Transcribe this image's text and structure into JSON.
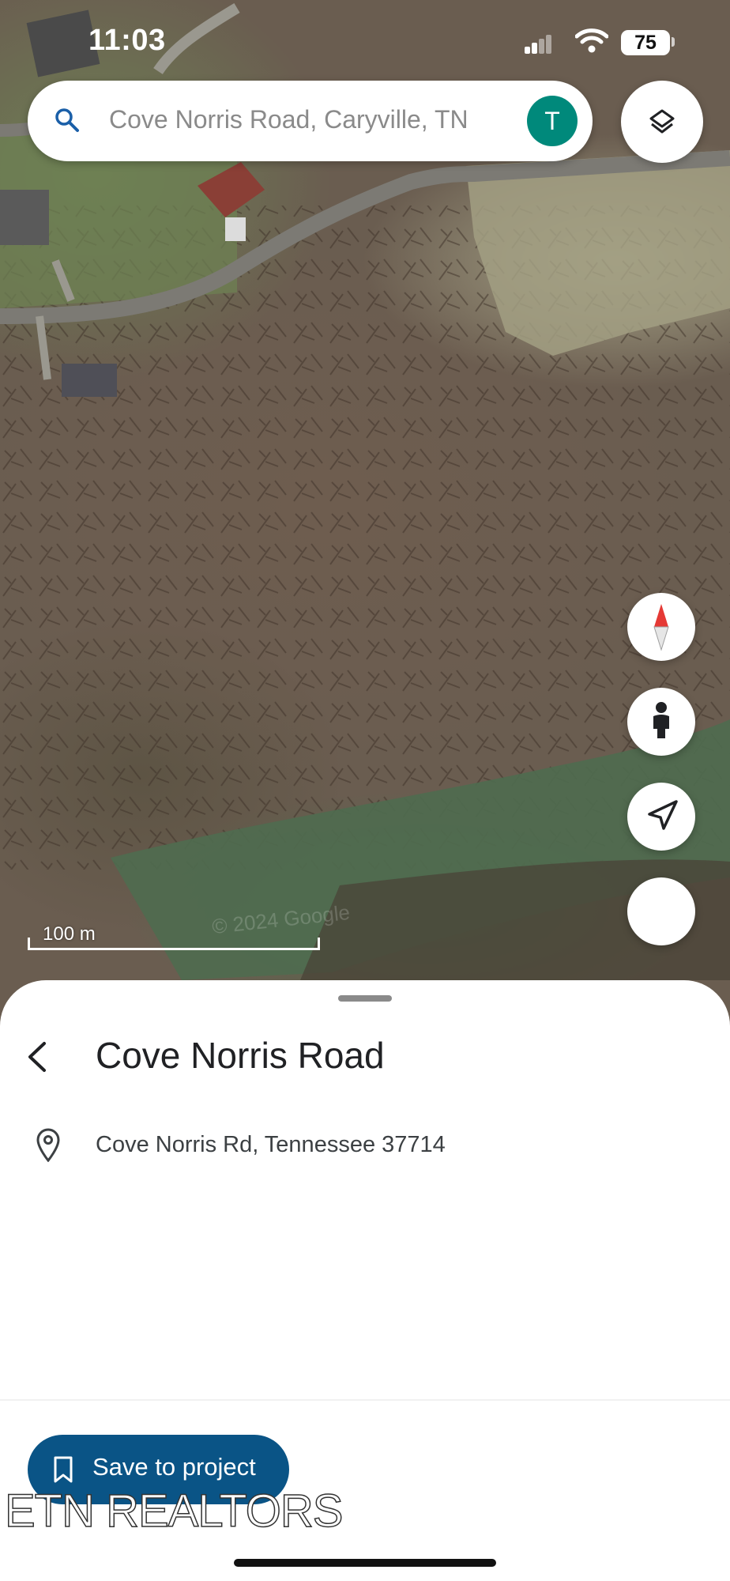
{
  "status_bar": {
    "time": "11:03",
    "battery": "75"
  },
  "search": {
    "query": "Cove Norris Road, Caryville, TN",
    "avatar_letter": "T",
    "avatar_color": "#00897b"
  },
  "map": {
    "scale_label": "100 m",
    "watermark": "© 2024 Google"
  },
  "controls": {
    "icons": [
      "layers-icon",
      "compass-icon",
      "street-view-icon",
      "navigate-icon"
    ]
  },
  "place": {
    "title": "Cove Norris Road",
    "address": "Cove Norris Rd, Tennessee 37714"
  },
  "actions": {
    "save_label": "Save to project",
    "save_color": "#0a5486"
  },
  "branding": {
    "text": "ETN REALTORS"
  }
}
